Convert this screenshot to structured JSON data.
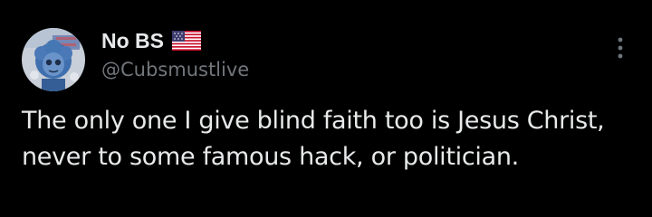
{
  "tweet": {
    "author": {
      "display_name": "No BS",
      "flag_icon": "us-flag-icon",
      "handle": "@Cubsmustlive"
    },
    "text": "The only one I give blind faith too is Jesus Christ, never to some famous hack, or politician.",
    "more_icon": "more-vertical-icon"
  },
  "colors": {
    "background": "#000000",
    "primary_text": "#e7e9ea",
    "secondary_text": "#71767b"
  }
}
